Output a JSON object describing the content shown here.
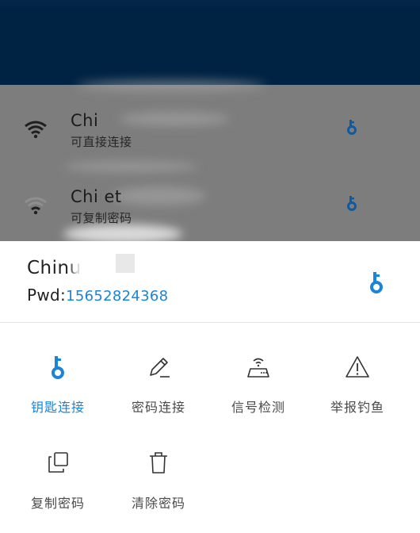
{
  "colors": {
    "header": "#012343",
    "overlay_list": "#7d7d7d",
    "accent": "#1a84d8",
    "label": "#4a4a4a"
  },
  "wifi_list": [
    {
      "name": "Chi",
      "status": "可直接连接",
      "icon": "wifi-icon",
      "action_icon": "key-icon"
    },
    {
      "name": "Chi      et",
      "status": "可复制密码",
      "icon": "wifi-icon",
      "action_icon": "key-icon"
    }
  ],
  "sheet": {
    "ssid": "Chinu",
    "pwd_label": "Pwd:",
    "pwd_value": "15652824368",
    "key_icon": "key-icon",
    "actions": [
      {
        "id": "key-connect",
        "label": "钥匙连接",
        "icon": "key-icon",
        "active": true
      },
      {
        "id": "password-connect",
        "label": "密码连接",
        "icon": "pencil-icon",
        "active": false
      },
      {
        "id": "signal-test",
        "label": "信号检测",
        "icon": "router-icon",
        "active": false
      },
      {
        "id": "report-phishing",
        "label": "举报钓鱼",
        "icon": "warning-icon",
        "active": false
      },
      {
        "id": "copy-password",
        "label": "复制密码",
        "icon": "copy-icon",
        "active": false
      },
      {
        "id": "clear-password",
        "label": "清除密码",
        "icon": "trash-icon",
        "active": false
      }
    ]
  }
}
